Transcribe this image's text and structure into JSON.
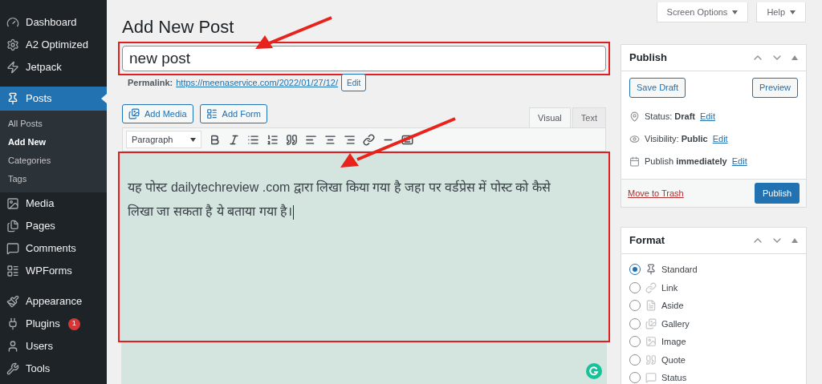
{
  "sidebar": {
    "groups": [
      [
        {
          "label": "Dashboard",
          "selected": false
        },
        {
          "label": "A2 Optimized",
          "selected": false
        },
        {
          "label": "Jetpack",
          "selected": false
        }
      ],
      [
        {
          "label": "Posts",
          "selected": true,
          "children": [
            {
              "label": "All Posts",
              "selected": false
            },
            {
              "label": "Add New",
              "selected": true
            },
            {
              "label": "Categories",
              "selected": false
            },
            {
              "label": "Tags",
              "selected": false
            }
          ]
        },
        {
          "label": "Media",
          "selected": false
        },
        {
          "label": "Pages",
          "selected": false
        },
        {
          "label": "Comments",
          "selected": false
        },
        {
          "label": "WPForms",
          "selected": false
        }
      ],
      [
        {
          "label": "Appearance",
          "selected": false
        },
        {
          "label": "Plugins",
          "selected": false,
          "badge": "1"
        },
        {
          "label": "Users",
          "selected": false
        },
        {
          "label": "Tools",
          "selected": false
        }
      ]
    ]
  },
  "screen_meta": [
    "Screen Options",
    "Help"
  ],
  "page_title": "Add New Post",
  "title_field": {
    "value": "new post"
  },
  "permalink": {
    "label": "Permalink:",
    "url": "https://meenaservice.com/2022/01/27/12/",
    "edit": "Edit"
  },
  "editor": {
    "media_buttons": [
      "Add Media",
      "Add Form"
    ],
    "tabs": [
      {
        "label": "Visual",
        "selected": true
      },
      {
        "label": "Text",
        "selected": false
      }
    ],
    "format_select": "Paragraph",
    "content": "यह पोस्ट dailytechreview .com द्वारा लिखा किया गया है जहा पर वर्डप्रेस में पोस्ट को कैसे लिखा जा सकता है ये बताया गया है।"
  },
  "publish_box": {
    "title": "Publish",
    "save_draft": "Save Draft",
    "preview": "Preview",
    "rows": [
      {
        "label": "Status:",
        "value": "Draft",
        "link": "Edit"
      },
      {
        "label": "Visibility:",
        "value": "Public",
        "link": "Edit"
      },
      {
        "label": "Publish",
        "value": "immediately",
        "link": "Edit"
      }
    ],
    "trash": "Move to Trash",
    "publish": "Publish"
  },
  "format_box": {
    "title": "Format",
    "options": [
      {
        "label": "Standard",
        "selected": true
      },
      {
        "label": "Link",
        "selected": false
      },
      {
        "label": "Aside",
        "selected": false
      },
      {
        "label": "Gallery",
        "selected": false
      },
      {
        "label": "Image",
        "selected": false
      },
      {
        "label": "Quote",
        "selected": false
      },
      {
        "label": "Status",
        "selected": false
      }
    ]
  }
}
